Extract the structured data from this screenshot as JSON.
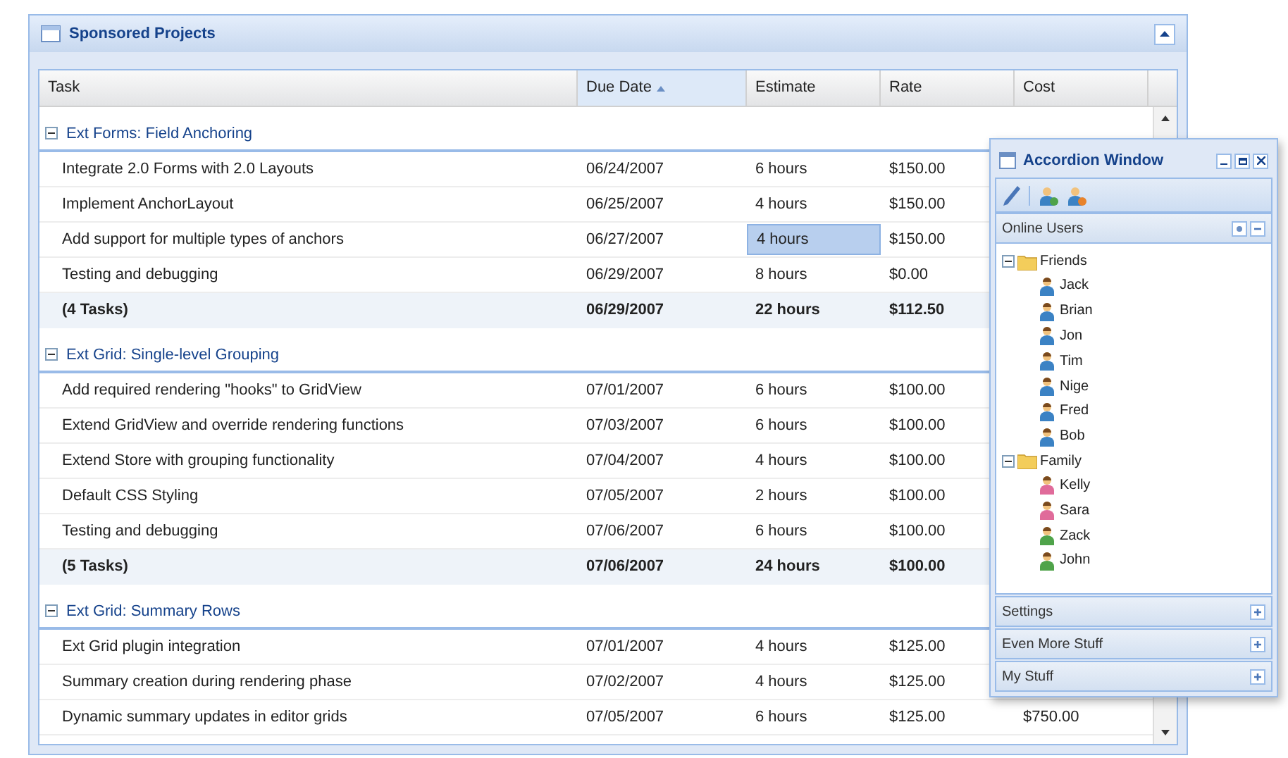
{
  "panel": {
    "title": "Sponsored Projects",
    "collapsed": false
  },
  "grid": {
    "columns": [
      {
        "label": "Task",
        "sorted": false
      },
      {
        "label": "Due Date",
        "sorted": true
      },
      {
        "label": "Estimate",
        "sorted": false
      },
      {
        "label": "Rate",
        "sorted": false
      },
      {
        "label": "Cost",
        "sorted": false
      }
    ],
    "groups": [
      {
        "title": "Ext Forms: Field Anchoring",
        "expanded": true,
        "rows": [
          {
            "task": "Integrate 2.0 Forms with 2.0 Layouts",
            "due": "06/24/2007",
            "estimate": "6 hours",
            "rate": "$150.00",
            "estimate_selected": false
          },
          {
            "task": "Implement AnchorLayout",
            "due": "06/25/2007",
            "estimate": "4 hours",
            "rate": "$150.00",
            "estimate_selected": false
          },
          {
            "task": "Add support for multiple types of anchors",
            "due": "06/27/2007",
            "estimate": "4 hours",
            "rate": "$150.00",
            "estimate_selected": true
          },
          {
            "task": "Testing and debugging",
            "due": "06/29/2007",
            "estimate": "8 hours",
            "rate": "$0.00",
            "estimate_selected": false
          }
        ],
        "summary": {
          "task": "(4 Tasks)",
          "due": "06/29/2007",
          "estimate": "22 hours",
          "rate": "$112.50"
        }
      },
      {
        "title": "Ext Grid: Single-level Grouping",
        "expanded": true,
        "rows": [
          {
            "task": "Add required rendering \"hooks\" to GridView",
            "due": "07/01/2007",
            "estimate": "6 hours",
            "rate": "$100.00",
            "estimate_selected": false
          },
          {
            "task": "Extend GridView and override rendering functions",
            "due": "07/03/2007",
            "estimate": "6 hours",
            "rate": "$100.00",
            "estimate_selected": false
          },
          {
            "task": "Extend Store with grouping functionality",
            "due": "07/04/2007",
            "estimate": "4 hours",
            "rate": "$100.00",
            "estimate_selected": false
          },
          {
            "task": "Default CSS Styling",
            "due": "07/05/2007",
            "estimate": "2 hours",
            "rate": "$100.00",
            "estimate_selected": false
          },
          {
            "task": "Testing and debugging",
            "due": "07/06/2007",
            "estimate": "6 hours",
            "rate": "$100.00",
            "estimate_selected": false
          }
        ],
        "summary": {
          "task": "(5 Tasks)",
          "due": "07/06/2007",
          "estimate": "24 hours",
          "rate": "$100.00"
        }
      },
      {
        "title": "Ext Grid: Summary Rows",
        "expanded": true,
        "rows": [
          {
            "task": "Ext Grid plugin integration",
            "due": "07/01/2007",
            "estimate": "4 hours",
            "rate": "$125.00",
            "estimate_selected": false
          },
          {
            "task": "Summary creation during rendering phase",
            "due": "07/02/2007",
            "estimate": "4 hours",
            "rate": "$125.00",
            "estimate_selected": false
          },
          {
            "task": "Dynamic summary updates in editor grids",
            "due": "07/05/2007",
            "estimate": "6 hours",
            "rate": "$125.00",
            "cost": "$750.00",
            "estimate_selected": false
          }
        ]
      }
    ]
  },
  "accordion_window": {
    "title": "Accordion Window",
    "sections": [
      {
        "title": "Online Users",
        "expanded": true,
        "tree": [
          {
            "label": "Friends",
            "expanded": true,
            "children": [
              {
                "label": "Jack",
                "color": "#3b82c4"
              },
              {
                "label": "Brian",
                "color": "#3b82c4"
              },
              {
                "label": "Jon",
                "color": "#3b82c4"
              },
              {
                "label": "Tim",
                "color": "#3b82c4"
              },
              {
                "label": "Nige",
                "color": "#3b82c4"
              },
              {
                "label": "Fred",
                "color": "#3b82c4"
              },
              {
                "label": "Bob",
                "color": "#3b82c4"
              }
            ]
          },
          {
            "label": "Family",
            "expanded": true,
            "children": [
              {
                "label": "Kelly",
                "color": "#e06b9a"
              },
              {
                "label": "Sara",
                "color": "#e06b9a"
              },
              {
                "label": "Zack",
                "color": "#4fa34a"
              },
              {
                "label": "John",
                "color": "#4fa34a"
              }
            ]
          }
        ]
      },
      {
        "title": "Settings",
        "expanded": false
      },
      {
        "title": "Even More Stuff",
        "expanded": false
      },
      {
        "title": "My Stuff",
        "expanded": false
      }
    ]
  }
}
